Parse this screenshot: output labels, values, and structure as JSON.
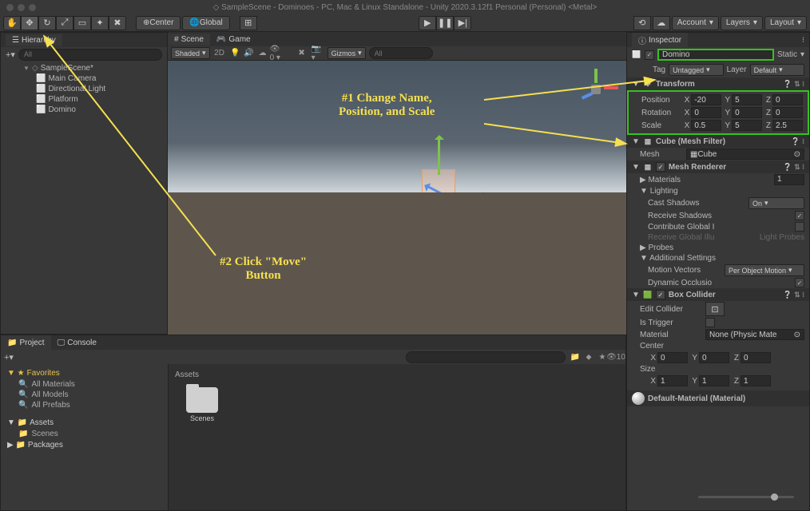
{
  "title": "SampleScene - Dominoes - PC, Mac & Linux Standalone - Unity 2020.3.12f1 Personal (Personal) <Metal>",
  "toolbar": {
    "center": "Center",
    "global": "Global",
    "account": "Account",
    "layers": "Layers",
    "layout": "Layout"
  },
  "hierarchy": {
    "title": "Hierarchy",
    "search_placeholder": "All",
    "scene": "SampleScene*",
    "items": [
      "Main Camera",
      "Directional Light",
      "Platform",
      "Domino"
    ]
  },
  "scene": {
    "tab": "Scene",
    "game_tab": "Game",
    "shaded": "Shaded",
    "twoD": "2D",
    "gizmos": "Gizmos",
    "search_placeholder": "All"
  },
  "inspector": {
    "title": "Inspector",
    "name": "Domino",
    "static": "Static",
    "tag_label": "Tag",
    "tag": "Untagged",
    "layer_label": "Layer",
    "layer": "Default",
    "transform": {
      "title": "Transform",
      "position_label": "Position",
      "rotation_label": "Rotation",
      "scale_label": "Scale",
      "position": {
        "x": "-20",
        "y": "5",
        "z": "0"
      },
      "rotation": {
        "x": "0",
        "y": "0",
        "z": "0"
      },
      "scale": {
        "x": "0.5",
        "y": "5",
        "z": "2.5"
      }
    },
    "meshfilter": {
      "title": "Cube (Mesh Filter)",
      "mesh_label": "Mesh",
      "mesh": "Cube"
    },
    "meshrenderer": {
      "title": "Mesh Renderer",
      "materials": {
        "label": "Materials",
        "count": "1"
      },
      "lighting": "Lighting",
      "cast_shadows": {
        "label": "Cast Shadows",
        "value": "On"
      },
      "receive_shadows": "Receive Shadows",
      "contribute_gi": "Contribute Global I",
      "receive_gi": {
        "label": "Receive Global Illu",
        "value": "Light Probes"
      },
      "probes": "Probes",
      "additional": "Additional Settings",
      "motion_vectors": {
        "label": "Motion Vectors",
        "value": "Per Object Motion"
      },
      "dynamic_occ": "Dynamic Occlusio"
    },
    "boxcollider": {
      "title": "Box Collider",
      "edit_label": "Edit Collider",
      "is_trigger": "Is Trigger",
      "material_label": "Material",
      "material": "None (Physic Mate",
      "center_label": "Center",
      "center": {
        "x": "0",
        "y": "0",
        "z": "0"
      },
      "size_label": "Size",
      "size": {
        "x": "1",
        "y": "1",
        "z": "1"
      }
    },
    "material": "Default-Material (Material)"
  },
  "project": {
    "tab": "Project",
    "console_tab": "Console",
    "favorites": "Favorites",
    "fav_items": [
      "All Materials",
      "All Models",
      "All Prefabs"
    ],
    "assets": "Assets",
    "assets_items": [
      "Scenes"
    ],
    "packages": "Packages",
    "breadcrumb": "Assets",
    "folders": [
      {
        "name": "Scenes"
      }
    ],
    "badge": "10"
  },
  "annotations": {
    "a1": "#1 Change Name,\nPosition, and Scale",
    "a2": "#2 Click \"Move\"\nButton"
  },
  "axis": {
    "x": "X",
    "y": "Y",
    "z": "Z"
  }
}
